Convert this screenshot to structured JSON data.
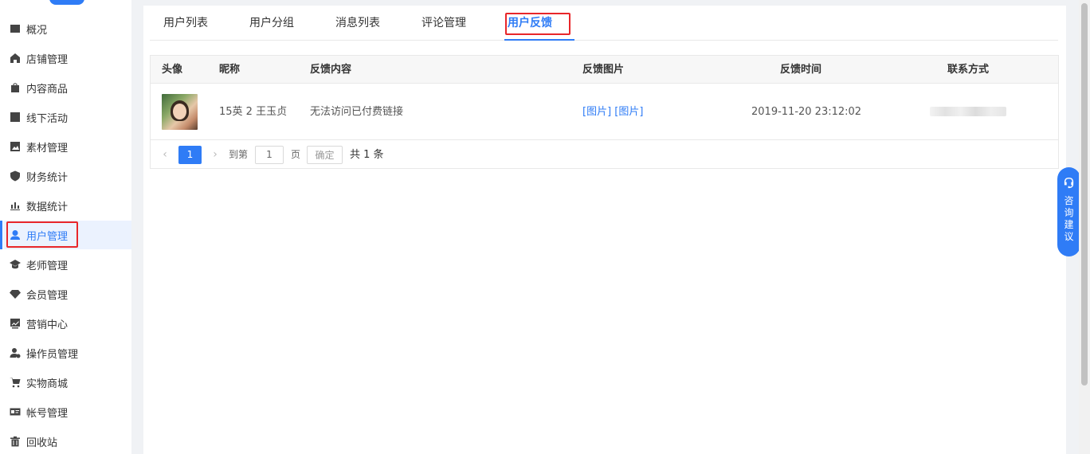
{
  "sidebar": {
    "items": [
      {
        "label": "概况",
        "icon": "dashboard-icon"
      },
      {
        "label": "店铺管理",
        "icon": "store-icon"
      },
      {
        "label": "内容商品",
        "icon": "bag-icon"
      },
      {
        "label": "线下活动",
        "icon": "flag-icon"
      },
      {
        "label": "素材管理",
        "icon": "image-icon"
      },
      {
        "label": "财务统计",
        "icon": "shield-icon"
      },
      {
        "label": "数据统计",
        "icon": "bar-chart-icon"
      },
      {
        "label": "用户管理",
        "icon": "user-icon",
        "active": true
      },
      {
        "label": "老师管理",
        "icon": "graduation-cap-icon"
      },
      {
        "label": "会员管理",
        "icon": "diamond-icon"
      },
      {
        "label": "营销中心",
        "icon": "trend-chart-icon"
      },
      {
        "label": "操作员管理",
        "icon": "operator-icon"
      },
      {
        "label": "实物商城",
        "icon": "cart-icon"
      },
      {
        "label": "帐号管理",
        "icon": "id-card-icon"
      },
      {
        "label": "回收站",
        "icon": "trash-icon"
      }
    ]
  },
  "tabs": [
    {
      "label": "用户列表"
    },
    {
      "label": "用户分组"
    },
    {
      "label": "消息列表"
    },
    {
      "label": "评论管理"
    },
    {
      "label": "用户反馈",
      "active": true
    }
  ],
  "table": {
    "columns": [
      "头像",
      "昵称",
      "反馈内容",
      "反馈图片",
      "反馈时间",
      "联系方式"
    ],
    "rows": [
      {
        "nickname": "15英 2 王玉贞",
        "content": "无法访问已付费链接",
        "images": [
          "[图片]",
          "[图片]"
        ],
        "time": "2019-11-20 23:12:02"
      }
    ]
  },
  "pager": {
    "prev": "‹",
    "current": "1",
    "next": "›",
    "goto_label": "到第",
    "goto_value": "1",
    "page_unit": "页",
    "confirm": "确定",
    "total": "共 1 条"
  },
  "float_help": {
    "chars": [
      "咨",
      "询",
      "建",
      "议"
    ]
  },
  "colors": {
    "accent": "#2f7cf6",
    "highlight": "#e8262a"
  }
}
